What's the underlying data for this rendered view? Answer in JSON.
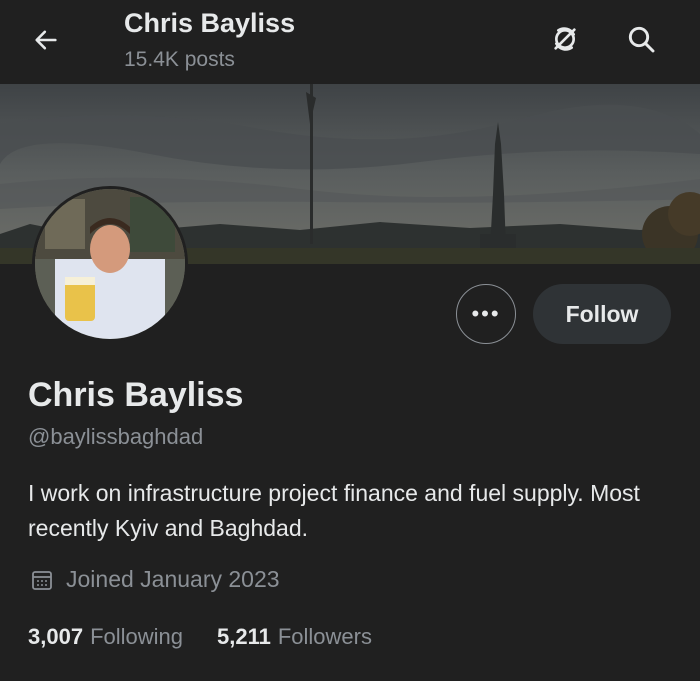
{
  "header": {
    "title": "Chris Bayliss",
    "posts_count": "15.4K posts",
    "icons": [
      "back-arrow-icon",
      "mute-icon",
      "search-icon"
    ]
  },
  "profile": {
    "name": "Chris Bayliss",
    "handle": "@baylissbaghdad",
    "bio": "I work on infrastructure project finance and fuel supply. Most recently Kyiv and Baghdad.",
    "joined": "Joined January 2023",
    "following_count": "3,007",
    "following_label": "Following",
    "followers_count": "5,211",
    "followers_label": "Followers"
  },
  "actions": {
    "more_label": "•••",
    "follow_label": "Follow"
  },
  "colors": {
    "background": "#202020",
    "primary_text": "#e7e9ea",
    "secondary_text": "#8b9096",
    "follow_button_bg": "#2f3336"
  }
}
